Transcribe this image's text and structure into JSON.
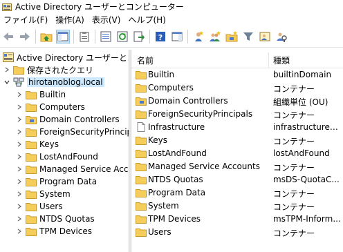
{
  "window": {
    "title": "Active Directory ユーザーとコンピューター"
  },
  "menu": [
    "ファイル(F)",
    "操作(A)",
    "表示(V)",
    "ヘルプ(H)"
  ],
  "tree": {
    "root": "Active Directory ユーザーとコンピ…",
    "saved_queries": "保存されたクエリ",
    "domain": "hirotanoblog.local",
    "children": [
      "Builtin",
      "Computers",
      "Domain Controllers",
      "ForeignSecurityPrincipa",
      "Keys",
      "LostAndFound",
      "Managed Service Acco",
      "Program Data",
      "System",
      "Users",
      "NTDS Quotas",
      "TPM Devices"
    ]
  },
  "list": {
    "columns": [
      "名前",
      "種類"
    ],
    "rows": [
      {
        "name": "Builtin",
        "type": "builtinDomain",
        "icon": "folder"
      },
      {
        "name": "Computers",
        "type": "コンテナー",
        "icon": "folder"
      },
      {
        "name": "Domain Controllers",
        "type": "組織単位 (OU)",
        "icon": "ou-folder"
      },
      {
        "name": "ForeignSecurityPrincipals",
        "type": "コンテナー",
        "icon": "folder"
      },
      {
        "name": "Infrastructure",
        "type": "infrastructureU...",
        "icon": "document"
      },
      {
        "name": "Keys",
        "type": "コンテナー",
        "icon": "folder"
      },
      {
        "name": "LostAndFound",
        "type": "lostAndFound",
        "icon": "folder"
      },
      {
        "name": "Managed Service Accounts",
        "type": "コンテナー",
        "icon": "folder"
      },
      {
        "name": "NTDS Quotas",
        "type": "msDS-QuotaC...",
        "icon": "folder"
      },
      {
        "name": "Program Data",
        "type": "コンテナー",
        "icon": "folder"
      },
      {
        "name": "System",
        "type": "コンテナー",
        "icon": "folder"
      },
      {
        "name": "TPM Devices",
        "type": "msTPM-Inform...",
        "icon": "folder"
      },
      {
        "name": "Users",
        "type": "コンテナー",
        "icon": "folder"
      }
    ]
  },
  "colors": {
    "folder": "#f5cd5a",
    "folder_dark": "#d9a82e",
    "selection": "#cce8ff"
  }
}
